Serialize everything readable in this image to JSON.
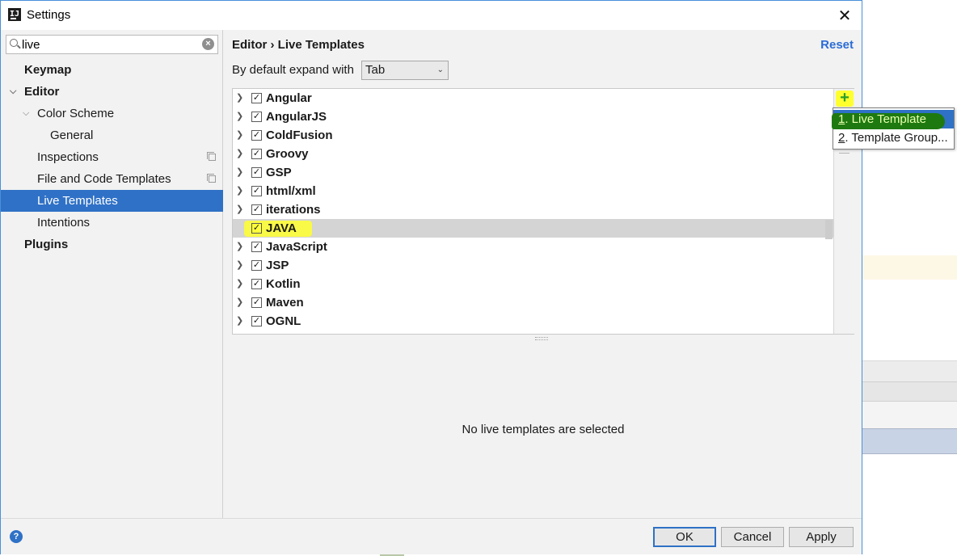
{
  "window": {
    "title": "Settings",
    "close_glyph": "✕",
    "app_icon_text": "IJ"
  },
  "search": {
    "value": "live",
    "clear_glyph": "×"
  },
  "tree": {
    "items": [
      {
        "label": "Keymap"
      },
      {
        "label": "Editor"
      },
      {
        "label": "Color Scheme"
      },
      {
        "label": "General"
      },
      {
        "label": "Inspections"
      },
      {
        "label": "File and Code Templates"
      },
      {
        "label": "Live Templates"
      },
      {
        "label": "Intentions"
      },
      {
        "label": "Plugins"
      }
    ]
  },
  "header": {
    "breadcrumb": "Editor › Live Templates",
    "reset": "Reset"
  },
  "expand": {
    "label": "By default expand with",
    "value": "Tab"
  },
  "templates": [
    {
      "name": "Angular",
      "checked": true
    },
    {
      "name": "AngularJS",
      "checked": true
    },
    {
      "name": "ColdFusion",
      "checked": true
    },
    {
      "name": "Groovy",
      "checked": true
    },
    {
      "name": "GSP",
      "checked": true
    },
    {
      "name": "html/xml",
      "checked": true
    },
    {
      "name": "iterations",
      "checked": true
    },
    {
      "name": "JAVA",
      "checked": true
    },
    {
      "name": "JavaScript",
      "checked": true
    },
    {
      "name": "JSP",
      "checked": true
    },
    {
      "name": "Kotlin",
      "checked": true
    },
    {
      "name": "Maven",
      "checked": true
    },
    {
      "name": "OGNL",
      "checked": true
    }
  ],
  "toolbar": {
    "add_glyph": "+"
  },
  "popup": {
    "items": [
      {
        "mnemonic": "1",
        "rest": ". Live Template"
      },
      {
        "mnemonic": "2",
        "rest": ". Template Group..."
      }
    ]
  },
  "details": {
    "empty_message": "No live templates are selected"
  },
  "buttons": {
    "ok": "OK",
    "cancel": "Cancel",
    "apply": "Apply",
    "help": "?"
  },
  "colors": {
    "accent": "#2f71c6",
    "highlight_yellow": "#ffff2e",
    "highlight_green": "#1e7a10",
    "link": "#2b6cd6"
  }
}
